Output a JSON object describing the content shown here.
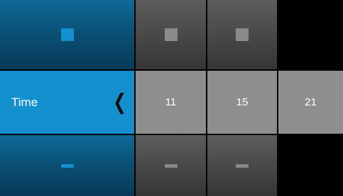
{
  "row_label": "Time",
  "values": [
    "11",
    "15",
    "21"
  ],
  "icons": {
    "increment": "plus-icon",
    "decrement": "minus-icon",
    "collapse": "chevron-left-icon"
  },
  "colors": {
    "accent": "#1590cf",
    "label_bg": "#0a4f74",
    "value_bg": "#8e8e8e",
    "stepper_bg": "#474747",
    "stepper_icon": "#8a8a8a"
  }
}
